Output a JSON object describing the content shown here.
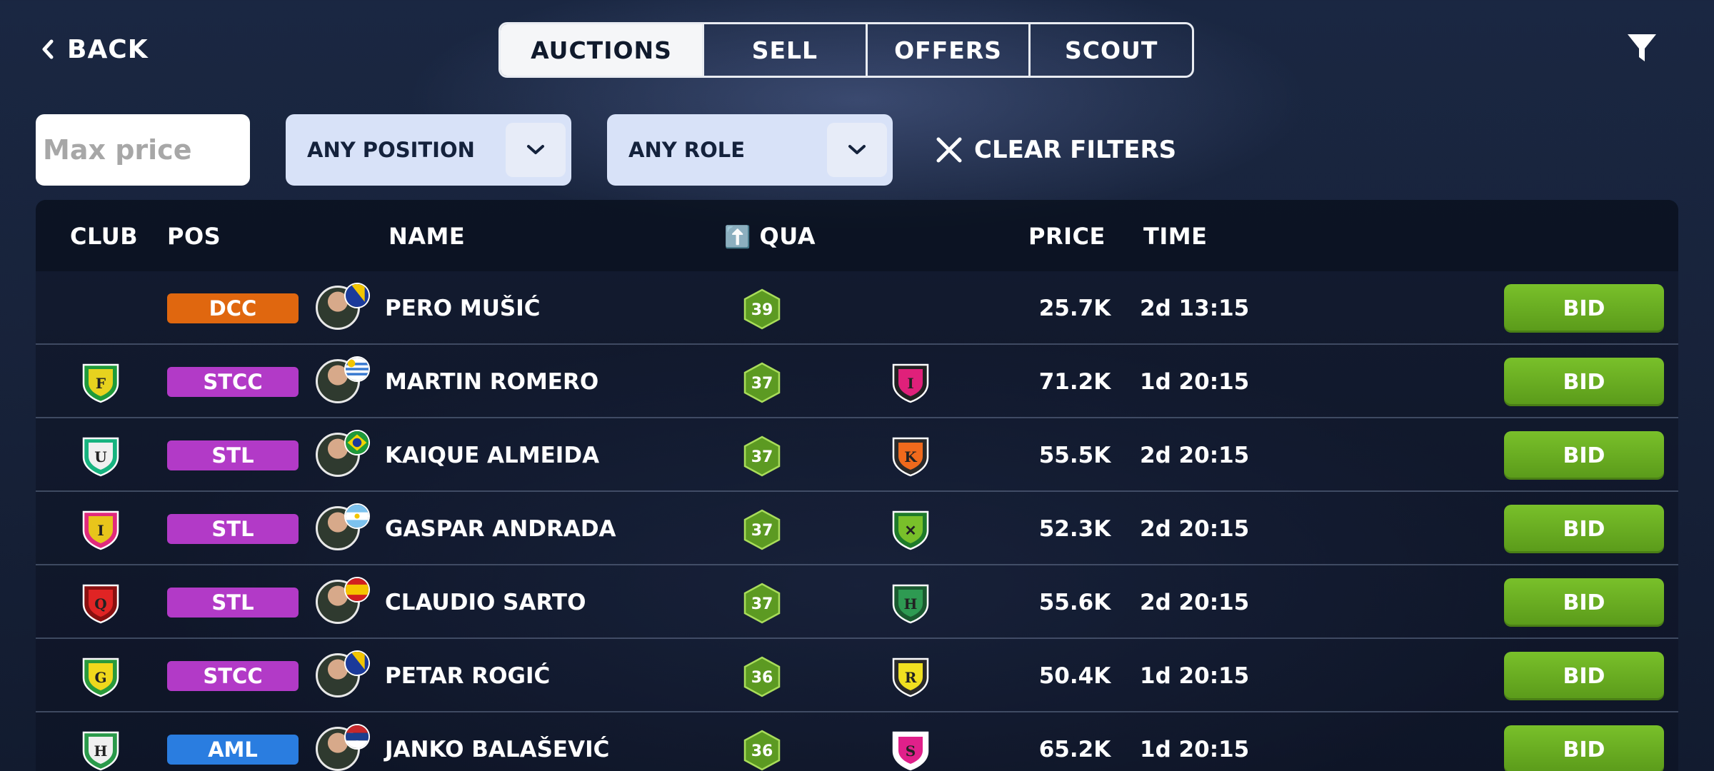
{
  "header": {
    "back_label": "BACK",
    "tabs": [
      {
        "label": "AUCTIONS",
        "active": true
      },
      {
        "label": "SELL",
        "active": false
      },
      {
        "label": "OFFERS",
        "active": false
      },
      {
        "label": "SCOUT",
        "active": false
      }
    ],
    "filter_icon": "funnel-icon"
  },
  "filters": {
    "max_price_placeholder": "Max price",
    "max_price_value": "",
    "position_select": "ANY POSITION",
    "role_select": "ANY ROLE",
    "clear_label": "CLEAR FILTERS"
  },
  "table": {
    "columns": {
      "club": "CLUB",
      "pos": "POS",
      "name": "NAME",
      "qua": "QUA",
      "qua_sort_icon": "⬆️",
      "price": "PRICE",
      "time": "TIME"
    },
    "bid_label": "BID",
    "rows": [
      {
        "club": null,
        "pos": "DCC",
        "pos_color": "#e0670f",
        "name": "PERO MUŠIĆ",
        "flag": "bosnia",
        "quality": "39",
        "opponent": null,
        "price": "25.7K",
        "time": "2d 13:15"
      },
      {
        "club": {
          "letter": "F",
          "colors": [
            "#e7d21e",
            "#1f9a3a"
          ]
        },
        "pos": "STCC",
        "pos_color": "#b23ac7",
        "name": "MARTIN ROMERO",
        "flag": "uruguay",
        "quality": "37",
        "opponent": {
          "letter": "I",
          "colors": [
            "#e0207a",
            "#222"
          ]
        },
        "price": "71.2K",
        "time": "1d 20:15"
      },
      {
        "club": {
          "letter": "U",
          "colors": [
            "#f0f0f0",
            "#17b37f"
          ]
        },
        "pos": "STL",
        "pos_color": "#b23ac7",
        "name": "KAIQUE ALMEIDA",
        "flag": "brazil",
        "quality": "37",
        "opponent": {
          "letter": "K",
          "colors": [
            "#f06a1c",
            "#2a2a2a"
          ]
        },
        "price": "55.5K",
        "time": "2d 20:15"
      },
      {
        "club": {
          "letter": "I",
          "colors": [
            "#e8c51b",
            "#e02a7c"
          ]
        },
        "pos": "STL",
        "pos_color": "#b23ac7",
        "name": "GASPAR ANDRADA",
        "flag": "argentina",
        "quality": "37",
        "opponent": {
          "letter": "✕",
          "colors": [
            "#79c02a",
            "#1e7a2a"
          ]
        },
        "price": "52.3K",
        "time": "2d 20:15"
      },
      {
        "club": {
          "letter": "Q",
          "colors": [
            "#e02424",
            "#8a1010"
          ]
        },
        "pos": "STL",
        "pos_color": "#b23ac7",
        "name": "CLAUDIO SARTO",
        "flag": "spain",
        "quality": "37",
        "opponent": {
          "letter": "H",
          "colors": [
            "#2e9a52",
            "#1a5a30"
          ]
        },
        "price": "55.6K",
        "time": "2d 20:15"
      },
      {
        "club": {
          "letter": "G",
          "colors": [
            "#f0d81c",
            "#2a9a3a"
          ]
        },
        "pos": "STCC",
        "pos_color": "#b23ac7",
        "name": "PETAR ROGIĆ",
        "flag": "bosnia",
        "quality": "36",
        "opponent": {
          "letter": "R",
          "colors": [
            "#f0e020",
            "#2a2a2a"
          ]
        },
        "price": "50.4K",
        "time": "1d 20:15"
      },
      {
        "club": {
          "letter": "H",
          "colors": [
            "#f0f0f0",
            "#2a9a4a"
          ]
        },
        "pos": "AML",
        "pos_color": "#2a7de0",
        "name": "JANKO BALAŠEVIĆ",
        "flag": "serbia",
        "quality": "36",
        "opponent": {
          "letter": "S",
          "colors": [
            "#e0208a",
            "#ffffff"
          ]
        },
        "price": "65.2K",
        "time": "1d 20:15"
      }
    ]
  }
}
